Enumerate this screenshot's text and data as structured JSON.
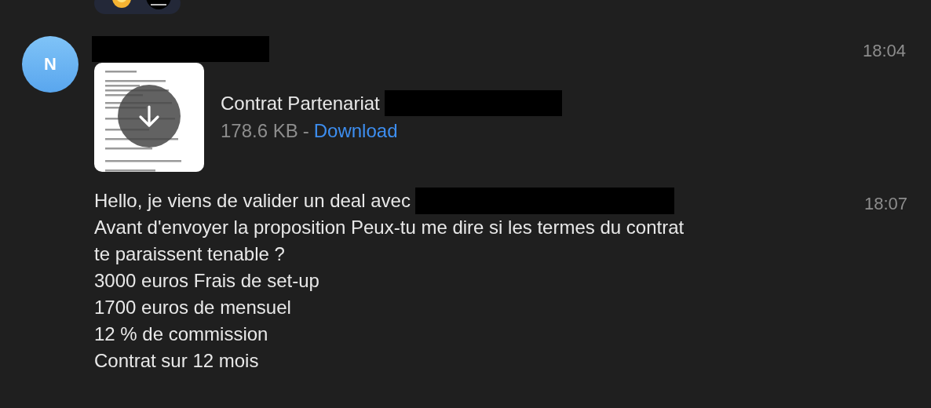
{
  "sender": {
    "initial": "N"
  },
  "messages": [
    {
      "kind": "file",
      "time": "18:04",
      "file_name": "Contrat Partenariat",
      "file_size": "178.6 KB",
      "separator": "-",
      "action": "Download"
    },
    {
      "kind": "text",
      "time": "18:07",
      "lines": [
        "Hello, je viens de valider un deal avec",
        "Avant d'envoyer la proposition Peux-tu me dire si les termes du contrat",
        "te paraissent tenable ?",
        "3000 euros Frais de set-up",
        "1700 euros de mensuel",
        "12 % de commission",
        "Contrat sur 12 mois"
      ]
    }
  ]
}
